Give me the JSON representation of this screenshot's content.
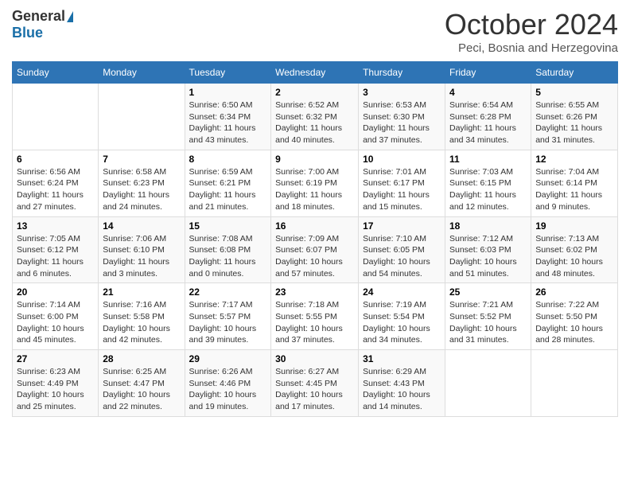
{
  "logo": {
    "general": "General",
    "blue": "Blue"
  },
  "title": "October 2024",
  "location": "Peci, Bosnia and Herzegovina",
  "days_of_week": [
    "Sunday",
    "Monday",
    "Tuesday",
    "Wednesday",
    "Thursday",
    "Friday",
    "Saturday"
  ],
  "weeks": [
    [
      {
        "day": "",
        "info": ""
      },
      {
        "day": "",
        "info": ""
      },
      {
        "day": "1",
        "info": "Sunrise: 6:50 AM\nSunset: 6:34 PM\nDaylight: 11 hours and 43 minutes."
      },
      {
        "day": "2",
        "info": "Sunrise: 6:52 AM\nSunset: 6:32 PM\nDaylight: 11 hours and 40 minutes."
      },
      {
        "day": "3",
        "info": "Sunrise: 6:53 AM\nSunset: 6:30 PM\nDaylight: 11 hours and 37 minutes."
      },
      {
        "day": "4",
        "info": "Sunrise: 6:54 AM\nSunset: 6:28 PM\nDaylight: 11 hours and 34 minutes."
      },
      {
        "day": "5",
        "info": "Sunrise: 6:55 AM\nSunset: 6:26 PM\nDaylight: 11 hours and 31 minutes."
      }
    ],
    [
      {
        "day": "6",
        "info": "Sunrise: 6:56 AM\nSunset: 6:24 PM\nDaylight: 11 hours and 27 minutes."
      },
      {
        "day": "7",
        "info": "Sunrise: 6:58 AM\nSunset: 6:23 PM\nDaylight: 11 hours and 24 minutes."
      },
      {
        "day": "8",
        "info": "Sunrise: 6:59 AM\nSunset: 6:21 PM\nDaylight: 11 hours and 21 minutes."
      },
      {
        "day": "9",
        "info": "Sunrise: 7:00 AM\nSunset: 6:19 PM\nDaylight: 11 hours and 18 minutes."
      },
      {
        "day": "10",
        "info": "Sunrise: 7:01 AM\nSunset: 6:17 PM\nDaylight: 11 hours and 15 minutes."
      },
      {
        "day": "11",
        "info": "Sunrise: 7:03 AM\nSunset: 6:15 PM\nDaylight: 11 hours and 12 minutes."
      },
      {
        "day": "12",
        "info": "Sunrise: 7:04 AM\nSunset: 6:14 PM\nDaylight: 11 hours and 9 minutes."
      }
    ],
    [
      {
        "day": "13",
        "info": "Sunrise: 7:05 AM\nSunset: 6:12 PM\nDaylight: 11 hours and 6 minutes."
      },
      {
        "day": "14",
        "info": "Sunrise: 7:06 AM\nSunset: 6:10 PM\nDaylight: 11 hours and 3 minutes."
      },
      {
        "day": "15",
        "info": "Sunrise: 7:08 AM\nSunset: 6:08 PM\nDaylight: 11 hours and 0 minutes."
      },
      {
        "day": "16",
        "info": "Sunrise: 7:09 AM\nSunset: 6:07 PM\nDaylight: 10 hours and 57 minutes."
      },
      {
        "day": "17",
        "info": "Sunrise: 7:10 AM\nSunset: 6:05 PM\nDaylight: 10 hours and 54 minutes."
      },
      {
        "day": "18",
        "info": "Sunrise: 7:12 AM\nSunset: 6:03 PM\nDaylight: 10 hours and 51 minutes."
      },
      {
        "day": "19",
        "info": "Sunrise: 7:13 AM\nSunset: 6:02 PM\nDaylight: 10 hours and 48 minutes."
      }
    ],
    [
      {
        "day": "20",
        "info": "Sunrise: 7:14 AM\nSunset: 6:00 PM\nDaylight: 10 hours and 45 minutes."
      },
      {
        "day": "21",
        "info": "Sunrise: 7:16 AM\nSunset: 5:58 PM\nDaylight: 10 hours and 42 minutes."
      },
      {
        "day": "22",
        "info": "Sunrise: 7:17 AM\nSunset: 5:57 PM\nDaylight: 10 hours and 39 minutes."
      },
      {
        "day": "23",
        "info": "Sunrise: 7:18 AM\nSunset: 5:55 PM\nDaylight: 10 hours and 37 minutes."
      },
      {
        "day": "24",
        "info": "Sunrise: 7:19 AM\nSunset: 5:54 PM\nDaylight: 10 hours and 34 minutes."
      },
      {
        "day": "25",
        "info": "Sunrise: 7:21 AM\nSunset: 5:52 PM\nDaylight: 10 hours and 31 minutes."
      },
      {
        "day": "26",
        "info": "Sunrise: 7:22 AM\nSunset: 5:50 PM\nDaylight: 10 hours and 28 minutes."
      }
    ],
    [
      {
        "day": "27",
        "info": "Sunrise: 6:23 AM\nSunset: 4:49 PM\nDaylight: 10 hours and 25 minutes."
      },
      {
        "day": "28",
        "info": "Sunrise: 6:25 AM\nSunset: 4:47 PM\nDaylight: 10 hours and 22 minutes."
      },
      {
        "day": "29",
        "info": "Sunrise: 6:26 AM\nSunset: 4:46 PM\nDaylight: 10 hours and 19 minutes."
      },
      {
        "day": "30",
        "info": "Sunrise: 6:27 AM\nSunset: 4:45 PM\nDaylight: 10 hours and 17 minutes."
      },
      {
        "day": "31",
        "info": "Sunrise: 6:29 AM\nSunset: 4:43 PM\nDaylight: 10 hours and 14 minutes."
      },
      {
        "day": "",
        "info": ""
      },
      {
        "day": "",
        "info": ""
      }
    ]
  ]
}
